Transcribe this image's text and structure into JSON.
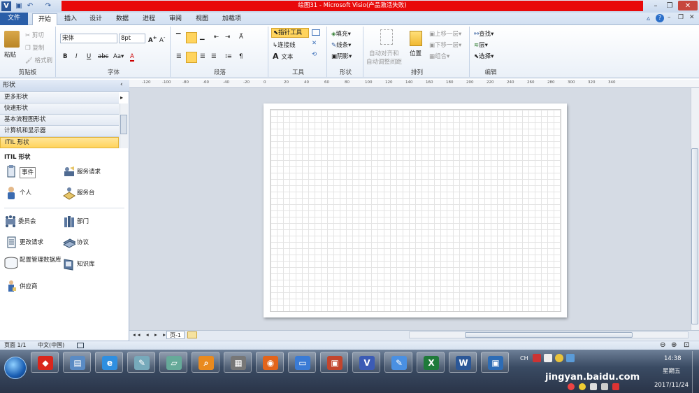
{
  "title": {
    "text": "绘图31 - Microsoft Visio(产品激活失败)"
  },
  "quick_access": {
    "app_icon": "V"
  },
  "tabs": {
    "file": "文件",
    "home": "开始",
    "items": [
      "插入",
      "设计",
      "数据",
      "进程",
      "审阅",
      "视图",
      "加载项"
    ]
  },
  "ribbon": {
    "clipboard": {
      "paste": "粘贴",
      "cut": "剪切",
      "copy": "复制",
      "format_painter": "格式刷",
      "label": "剪贴板"
    },
    "font": {
      "family": "宋体",
      "size": "8pt",
      "label": "字体"
    },
    "paragraph": {
      "label": "段落"
    },
    "tools": {
      "pointer": "指针工具",
      "connector": "连接线",
      "text": "文本",
      "label": "工具"
    },
    "shape": {
      "fill": "填充",
      "line": "线条",
      "shadow": "阴影",
      "label": "形状"
    },
    "arrange": {
      "auto_align": "自动对齐和",
      "auto_spacing": "自动调整间距",
      "position": "位置",
      "bring_forward": "上移一层",
      "send_backward": "下移一层",
      "group": "组合",
      "label": "排列"
    },
    "editing": {
      "find": "查找",
      "layer": "层",
      "select": "选择",
      "label": "编辑"
    }
  },
  "shapes_pane": {
    "title": "形状",
    "stencils": [
      "更多形状",
      "快速形状",
      "基本流程图形状",
      "计算机和显示器",
      "ITIL 形状"
    ],
    "section": "ITIL 形状",
    "shapes": [
      {
        "label": "事件",
        "icon": "incident-icon"
      },
      {
        "label": "服务请求",
        "icon": "service-request-icon"
      },
      {
        "label": "个人",
        "icon": "person-icon"
      },
      {
        "label": "服务台",
        "icon": "service-desk-icon"
      },
      {
        "label": "委员会",
        "icon": "committee-icon"
      },
      {
        "label": "部门",
        "icon": "department-icon"
      },
      {
        "label": "更改请求",
        "icon": "change-request-icon"
      },
      {
        "label": "协议",
        "icon": "agreement-icon"
      },
      {
        "label": "配置管理数据库",
        "icon": "cmdb-icon"
      },
      {
        "label": "知识库",
        "icon": "knowledge-base-icon"
      },
      {
        "label": "供应商",
        "icon": "supplier-icon"
      }
    ]
  },
  "ruler": {
    "h_ticks": [
      "-120",
      "-100",
      "-80",
      "-60",
      "-40",
      "-20",
      "0",
      "20",
      "40",
      "60",
      "80",
      "100",
      "120",
      "140",
      "160",
      "180",
      "200",
      "220",
      "240",
      "260",
      "280",
      "300",
      "320",
      "340"
    ]
  },
  "page_tabs": {
    "page": "页-1"
  },
  "status": {
    "page": "页面 1/1",
    "language": "中文(中国)"
  },
  "taskbar": {
    "apps": [
      "360",
      "文件",
      "IE",
      "画图",
      "笔记",
      "搜索",
      "计算器",
      "Firefox",
      "会议",
      "PowerPoint",
      "Visio",
      "便签",
      "Excel",
      "Word",
      "远程"
    ]
  },
  "tray": {
    "lang": "CH",
    "time": "14:38",
    "weekday": "星期五",
    "date": "2017/11/24",
    "watermark": "jingyan.baidu.com"
  }
}
